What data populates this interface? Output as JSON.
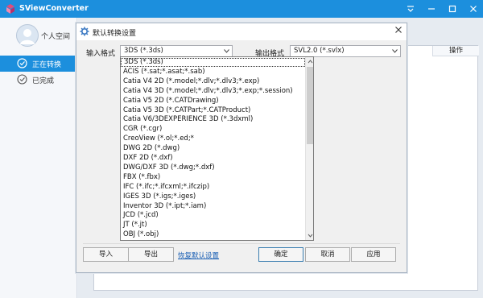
{
  "app": {
    "title": "SViewConverter",
    "brand_color": "#1c8fdd"
  },
  "sidebar": {
    "user_label": "个人空间",
    "items": [
      {
        "label": "正在转换",
        "active": true,
        "icon": "converting-icon"
      },
      {
        "label": "已完成",
        "active": false,
        "icon": "check-circle-icon"
      }
    ]
  },
  "list": {
    "op_header": "操作"
  },
  "dialog": {
    "title": "默认转换设置",
    "input_label": "输入格式",
    "output_label": "输出格式",
    "input_value": "3DS (*.3ds)",
    "output_value": "SVL2.0 (*.svlx)",
    "options": [
      "3DS (*.3ds)",
      "ACIS (*.sat;*.asat;*.sab)",
      "Catia V4 2D (*.model;*.dlv;*.dlv3;*.exp)",
      "Catia V4 3D (*.model;*.dlv;*.dlv3;*.exp;*.session)",
      "Catia V5 2D (*.CATDrawing)",
      "Catia V5 3D (*.CATPart;*.CATProduct)",
      "Catia V6/3DEXPERIENCE 3D (*.3dxml)",
      "CGR (*.cgr)",
      "CreoView (*.ol;*.ed;*",
      "DWG 2D (*.dwg)",
      "DXF 2D (*.dxf)",
      "DWG/DXF 3D (*.dwg;*.dxf)",
      "FBX (*.fbx)",
      "IFC (*.ifc;*.ifcxml;*.ifczip)",
      "IGES 3D (*.igs;*.iges)",
      "Inventor 3D (*.ipt;*.iam)",
      "JCD (*.jcd)",
      "JT (*.jt)",
      "OBJ (*.obj)"
    ],
    "buttons": {
      "import": "导入",
      "export": "导出",
      "restore": "恢复默认设置",
      "ok": "确定",
      "cancel": "取消",
      "apply": "应用"
    }
  }
}
